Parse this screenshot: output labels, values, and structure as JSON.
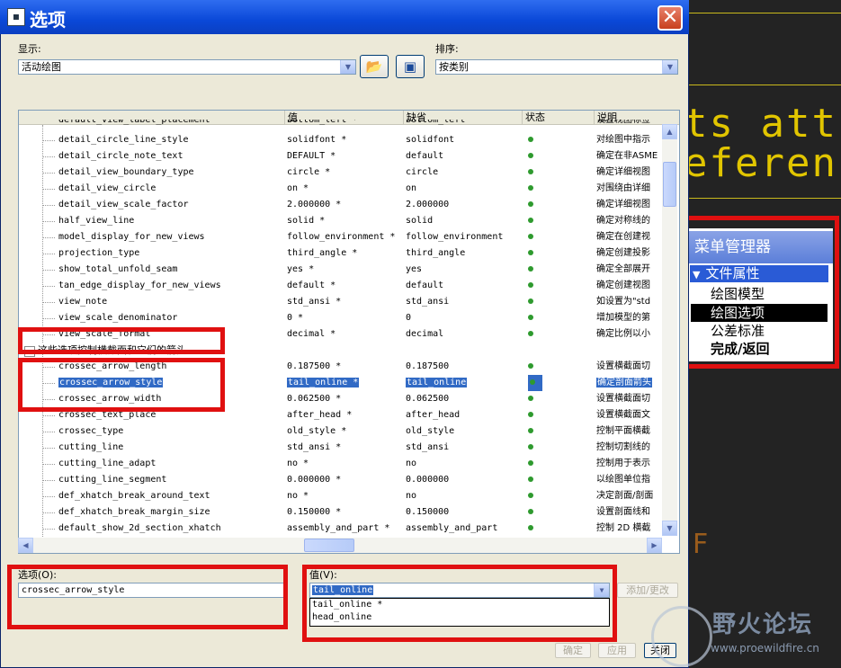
{
  "dialog": {
    "title": "选项",
    "display_label": "显示:",
    "display_value": "活动绘图",
    "sort_label": "排序:",
    "sort_value": "按类别",
    "option_label": "选项(O):",
    "option_value": "crossec_arrow_style",
    "value_label": "值(V):",
    "value_current": "tail_online",
    "value_options": [
      "tail_online *",
      "head_online"
    ],
    "add_change_button": "添加/更改",
    "ok_button": "确定",
    "apply_button": "应用",
    "close_button": "关闭"
  },
  "table": {
    "headers": [
      "值",
      "缺省",
      "状态",
      "说明"
    ],
    "top_partial": {
      "name": "default_view_label_placement",
      "value": "bottom_left *",
      "default": "bottom_left",
      "desc": "设置视图标签"
    },
    "rows_a": [
      {
        "name": "detail_circle_line_style",
        "value": "solidfont *",
        "default": "solidfont",
        "desc": "对绘图中指示"
      },
      {
        "name": "detail_circle_note_text",
        "value": "DEFAULT *",
        "default": "default",
        "desc": "确定在非ASME"
      },
      {
        "name": "detail_view_boundary_type",
        "value": "circle *",
        "default": "circle",
        "desc": "确定详细视图"
      },
      {
        "name": "detail_view_circle",
        "value": "on *",
        "default": "on",
        "desc": "对围绕由详细"
      },
      {
        "name": "detail_view_scale_factor",
        "value": "2.000000 *",
        "default": "2.000000",
        "desc": "确定详细视图"
      },
      {
        "name": "half_view_line",
        "value": "solid *",
        "default": "solid",
        "desc": "确定对称线的"
      },
      {
        "name": "model_display_for_new_views",
        "value": "follow_environment *",
        "default": "follow_environment",
        "desc": "确定在创建视"
      },
      {
        "name": "projection_type",
        "value": "third_angle *",
        "default": "third_angle",
        "desc": "确定创建投影"
      },
      {
        "name": "show_total_unfold_seam",
        "value": "yes *",
        "default": "yes",
        "desc": "确定全部展开"
      },
      {
        "name": "tan_edge_display_for_new_views",
        "value": "default *",
        "default": "default",
        "desc": "确定创建视图"
      },
      {
        "name": "view_note",
        "value": "std_ansi *",
        "default": "std_ansi",
        "desc": "如设置为\"std"
      },
      {
        "name": "view_scale_denominator",
        "value": "0 *",
        "default": "0",
        "desc": "增加模型的第"
      },
      {
        "name": "view_scale_format",
        "value": "decimal *",
        "default": "decimal",
        "desc": "确定比例以小"
      }
    ],
    "group_title": "这些选项控制横截面和它们的箭头",
    "rows_b": [
      {
        "name": "crossec_arrow_length",
        "value": "0.187500 *",
        "default": "0.187500",
        "desc": "设置横截面切"
      },
      {
        "name": "crossec_arrow_style",
        "value": "tail_online *",
        "default": "tail_online",
        "desc": "确定剖面箭头"
      },
      {
        "name": "crossec_arrow_width",
        "value": "0.062500 *",
        "default": "0.062500",
        "desc": "设置横截面切"
      },
      {
        "name": "crossec_text_place",
        "value": "after_head *",
        "default": "after_head",
        "desc": "设置横截面文"
      },
      {
        "name": "crossec_type",
        "value": "old_style *",
        "default": "old_style",
        "desc": "控制平面横截"
      },
      {
        "name": "cutting_line",
        "value": "std_ansi *",
        "default": "std_ansi",
        "desc": "控制切割线的"
      },
      {
        "name": "cutting_line_adapt",
        "value": "no *",
        "default": "no",
        "desc": "控制用于表示"
      },
      {
        "name": "cutting_line_segment",
        "value": "0.000000 *",
        "default": "0.000000",
        "desc": "以绘图单位指"
      },
      {
        "name": "def_xhatch_break_around_text",
        "value": "no *",
        "default": "no",
        "desc": "决定剖面/剖面"
      },
      {
        "name": "def_xhatch_break_margin_size",
        "value": "0.150000 *",
        "default": "0.150000",
        "desc": "设置剖面线和"
      },
      {
        "name": "default_show_2d_section_xhatch",
        "value": "assembly_and_part *",
        "default": "assembly_and_part",
        "desc": "控制 2D 横截"
      }
    ]
  },
  "menu_manager": {
    "title": "菜单管理器",
    "section": "文件属性",
    "items": [
      "绘图模型",
      "绘图选项",
      "公差标准",
      "完成/返回"
    ],
    "selected_index": 1
  },
  "background": {
    "text1": "ts att",
    "text2": "eferen",
    "letter": "F"
  },
  "watermark": {
    "title": "野火论坛",
    "url": "www.proewildfire.cn"
  }
}
